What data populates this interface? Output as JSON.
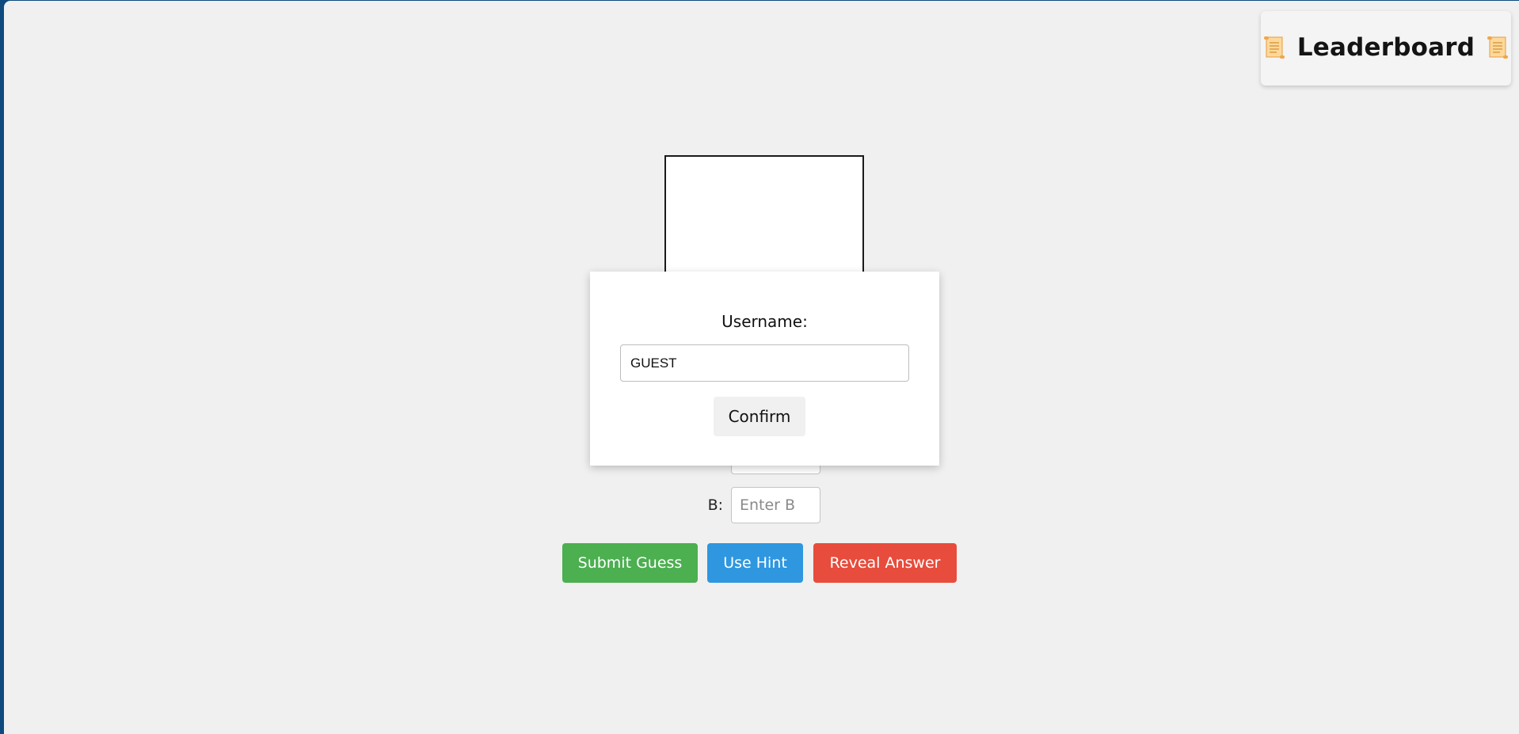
{
  "leaderboard": {
    "title": "Leaderboard",
    "icon_left": "scroll-icon",
    "icon_right": "scroll-icon"
  },
  "game": {
    "field_b": {
      "label": "B:",
      "placeholder": "Enter B"
    },
    "buttons": {
      "submit": "Submit Guess",
      "hint": "Use Hint",
      "reveal": "Reveal Answer"
    }
  },
  "modal": {
    "label": "Username:",
    "input_value": "GUEST",
    "confirm": "Confirm"
  },
  "colors": {
    "submit": "#4caf50",
    "hint": "#2e97df",
    "reveal": "#e74c3c",
    "background": "#f0f0f0",
    "frame": "#0e4a7e"
  }
}
